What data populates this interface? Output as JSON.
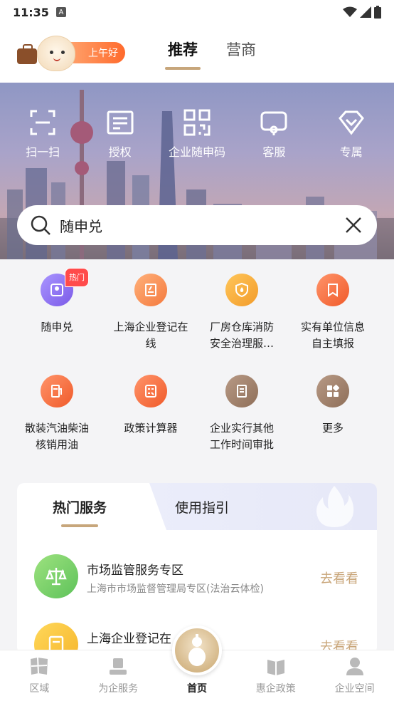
{
  "status": {
    "time": "11:35",
    "badge": "A"
  },
  "header": {
    "greeting": "上午好",
    "tabs": [
      {
        "label": "推荐",
        "active": true
      },
      {
        "label": "营商",
        "active": false
      }
    ]
  },
  "quick_actions": [
    {
      "label": "扫一扫",
      "icon": "scan-icon"
    },
    {
      "label": "授权",
      "icon": "authorize-icon"
    },
    {
      "label": "企业随申码",
      "icon": "qr-code-icon"
    },
    {
      "label": "客服",
      "icon": "customer-service-icon"
    },
    {
      "label": "专属",
      "icon": "diamond-icon"
    }
  ],
  "search": {
    "value": "随申兑"
  },
  "services": [
    {
      "label": "随申兑",
      "badge": "热门",
      "color": "#8c6df0",
      "icon": "badge-icon"
    },
    {
      "label": "上海企业登记在线",
      "color": "#f5844a",
      "icon": "register-icon"
    },
    {
      "label": "厂房仓库消防安全治理服…",
      "color": "#f3a43b",
      "icon": "fire-shield-icon"
    },
    {
      "label": "实有单位信息自主填报",
      "color": "#f36d3e",
      "icon": "bookmark-icon"
    },
    {
      "label": "散装汽油柴油核销用油",
      "color": "#f5733f",
      "icon": "fuel-icon"
    },
    {
      "label": "政策计算器",
      "color": "#f5733f",
      "icon": "calculator-icon"
    },
    {
      "label": "企业实行其他工作时间审批",
      "color": "#9a7a63",
      "icon": "document-icon"
    },
    {
      "label": "更多",
      "color": "#9a7a63",
      "icon": "grid-more-icon"
    }
  ],
  "panel": {
    "tabs": [
      {
        "label": "热门服务",
        "active": true
      },
      {
        "label": "使用指引",
        "active": false
      }
    ],
    "items": [
      {
        "title": "市场监管服务专区",
        "subtitle": "上海市市场监督管理局专区(法治云体检)",
        "action": "去看看",
        "color": "#7fd66f",
        "icon": "scale-icon"
      },
      {
        "title": "上海企业登记在",
        "subtitle": "",
        "action": "去看看",
        "color": "#f6c53b",
        "icon": "register-icon"
      }
    ]
  },
  "bottom_nav": [
    {
      "label": "区域",
      "active": false,
      "icon": "map-icon"
    },
    {
      "label": "为企服务",
      "active": false,
      "icon": "service-icon"
    },
    {
      "label": "首页",
      "active": true,
      "icon": "home-icon"
    },
    {
      "label": "惠企政策",
      "active": false,
      "icon": "policy-icon"
    },
    {
      "label": "企业空间",
      "active": false,
      "icon": "person-icon"
    }
  ]
}
